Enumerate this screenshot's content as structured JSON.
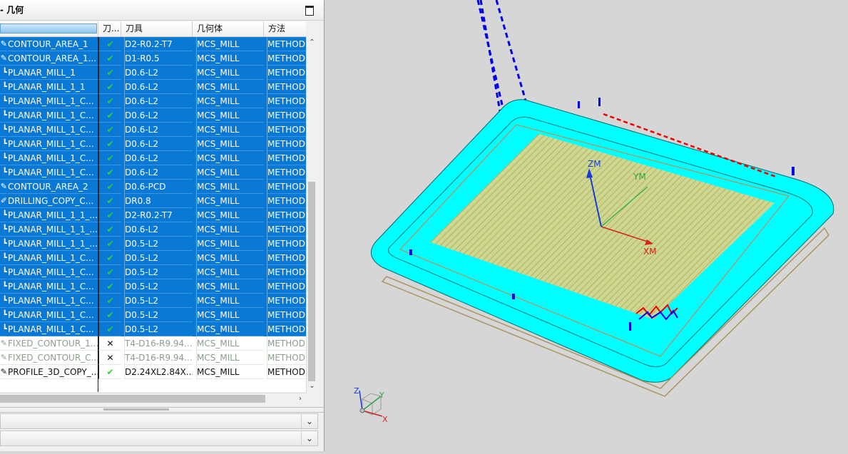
{
  "panel": {
    "title": "- 几何",
    "columns": {
      "name": "",
      "status": "刀...",
      "tool": "刀具",
      "geometry": "几何体",
      "method": "方法"
    }
  },
  "rows": [
    {
      "state": "sel",
      "icon": "✎",
      "name": "CONTOUR_AREA_1",
      "status": "✔",
      "tool": "D2-R0.2-T7",
      "geometry": "MCS_MILL",
      "method": "METHOD"
    },
    {
      "state": "sel",
      "icon": "✎",
      "name": "CONTOUR_AREA_1...",
      "status": "✔",
      "tool": "D1-R0.5",
      "geometry": "MCS_MILL",
      "method": "METHOD"
    },
    {
      "state": "sel",
      "icon": "┗",
      "name": "PLANAR_MILL_1",
      "status": "✔",
      "tool": "D0.6-L2",
      "geometry": "MCS_MILL",
      "method": "METHOD"
    },
    {
      "state": "sel",
      "icon": "┗",
      "name": "PLANAR_MILL_1_1",
      "status": "✔",
      "tool": "D0.6-L2",
      "geometry": "MCS_MILL",
      "method": "METHOD"
    },
    {
      "state": "sel",
      "icon": "┗",
      "name": "PLANAR_MILL_1_C...",
      "status": "✔",
      "tool": "D0.6-L2",
      "geometry": "MCS_MILL",
      "method": "METHOD"
    },
    {
      "state": "sel",
      "icon": "┗",
      "name": "PLANAR_MILL_1_C...",
      "status": "✔",
      "tool": "D0.6-L2",
      "geometry": "MCS_MILL",
      "method": "METHOD"
    },
    {
      "state": "sel",
      "icon": "┗",
      "name": "PLANAR_MILL_1_C...",
      "status": "✔",
      "tool": "D0.6-L2",
      "geometry": "MCS_MILL",
      "method": "METHOD"
    },
    {
      "state": "sel",
      "icon": "┗",
      "name": "PLANAR_MILL_1_C...",
      "status": "✔",
      "tool": "D0.6-L2",
      "geometry": "MCS_MILL",
      "method": "METHOD"
    },
    {
      "state": "sel",
      "icon": "┗",
      "name": "PLANAR_MILL_1_C...",
      "status": "✔",
      "tool": "D0.6-L2",
      "geometry": "MCS_MILL",
      "method": "METHOD"
    },
    {
      "state": "sel",
      "icon": "┗",
      "name": "PLANAR_MILL_1_C...",
      "status": "✔",
      "tool": "D0.6-L2",
      "geometry": "MCS_MILL",
      "method": "METHOD"
    },
    {
      "state": "sel",
      "icon": "✎",
      "name": "CONTOUR_AREA_2",
      "status": "✔",
      "tool": "D0.6-PCD",
      "geometry": "MCS_MILL",
      "method": "METHOD"
    },
    {
      "state": "sel",
      "icon": "✐",
      "name": "DRILLING_COPY_C...",
      "status": "✔",
      "tool": "DR0.8",
      "geometry": "MCS_MILL",
      "method": "METHOD"
    },
    {
      "state": "sel",
      "icon": "┗",
      "name": "PLANAR_MILL_1_1_...",
      "status": "✔",
      "tool": "D2-R0.2-T7",
      "geometry": "MCS_MILL",
      "method": "METHOD"
    },
    {
      "state": "sel",
      "icon": "┗",
      "name": "PLANAR_MILL_1_1_...",
      "status": "✔",
      "tool": "D0.6-L2",
      "geometry": "MCS_MILL",
      "method": "METHOD"
    },
    {
      "state": "sel",
      "icon": "┗",
      "name": "PLANAR_MILL_1_1_...",
      "status": "✔",
      "tool": "D0.5-L2",
      "geometry": "MCS_MILL",
      "method": "METHOD"
    },
    {
      "state": "sel",
      "icon": "┗",
      "name": "PLANAR_MILL_1_C...",
      "status": "✔",
      "tool": "D0.5-L2",
      "geometry": "MCS_MILL",
      "method": "METHOD"
    },
    {
      "state": "sel",
      "icon": "┗",
      "name": "PLANAR_MILL_1_C...",
      "status": "✔",
      "tool": "D0.5-L2",
      "geometry": "MCS_MILL",
      "method": "METHOD"
    },
    {
      "state": "sel",
      "icon": "┗",
      "name": "PLANAR_MILL_1_C...",
      "status": "✔",
      "tool": "D0.5-L2",
      "geometry": "MCS_MILL",
      "method": "METHOD"
    },
    {
      "state": "sel",
      "icon": "┗",
      "name": "PLANAR_MILL_1_C...",
      "status": "✔",
      "tool": "D0.5-L2",
      "geometry": "MCS_MILL",
      "method": "METHOD"
    },
    {
      "state": "sel",
      "icon": "┗",
      "name": "PLANAR_MILL_1_C...",
      "status": "✔",
      "tool": "D0.5-L2",
      "geometry": "MCS_MILL",
      "method": "METHOD"
    },
    {
      "state": "sel",
      "icon": "┗",
      "name": "PLANAR_MILL_1_C...",
      "status": "✔",
      "tool": "D0.5-L2",
      "geometry": "MCS_MILL",
      "method": "METHOD"
    },
    {
      "state": "dis",
      "icon": "✎",
      "name": "FIXED_CONTOUR_1...",
      "status": "✕",
      "tool": "T4-D16-R9.94...",
      "geometry": "MCS_MILL",
      "method": "METHOD"
    },
    {
      "state": "dis",
      "icon": "✎",
      "name": "FIXED_CONTOUR_C...",
      "status": "✕",
      "tool": "T4-D16-R9.94...",
      "geometry": "MCS_MILL",
      "method": "METHOD"
    },
    {
      "state": "nrm",
      "icon": "✎",
      "name": "PROFILE_3D_COPY_...",
      "status": "✔",
      "tool": "D2.24XL2.84X...",
      "geometry": "MCS_MILL",
      "method": "METHOD"
    }
  ],
  "viewport": {
    "axes": {
      "zm": "ZM",
      "ym": "YM",
      "xm": "XM"
    },
    "triad": {
      "z": "Z",
      "y": "Y",
      "x": "X"
    },
    "colors": {
      "part": "#00ffff",
      "toolpath": "#c8a94a",
      "approach": "#0000ee",
      "retract": "#ee0000",
      "zaxis": "#1a3dd6",
      "yaxis": "#2aa84a",
      "xaxis": "#d62020"
    }
  }
}
